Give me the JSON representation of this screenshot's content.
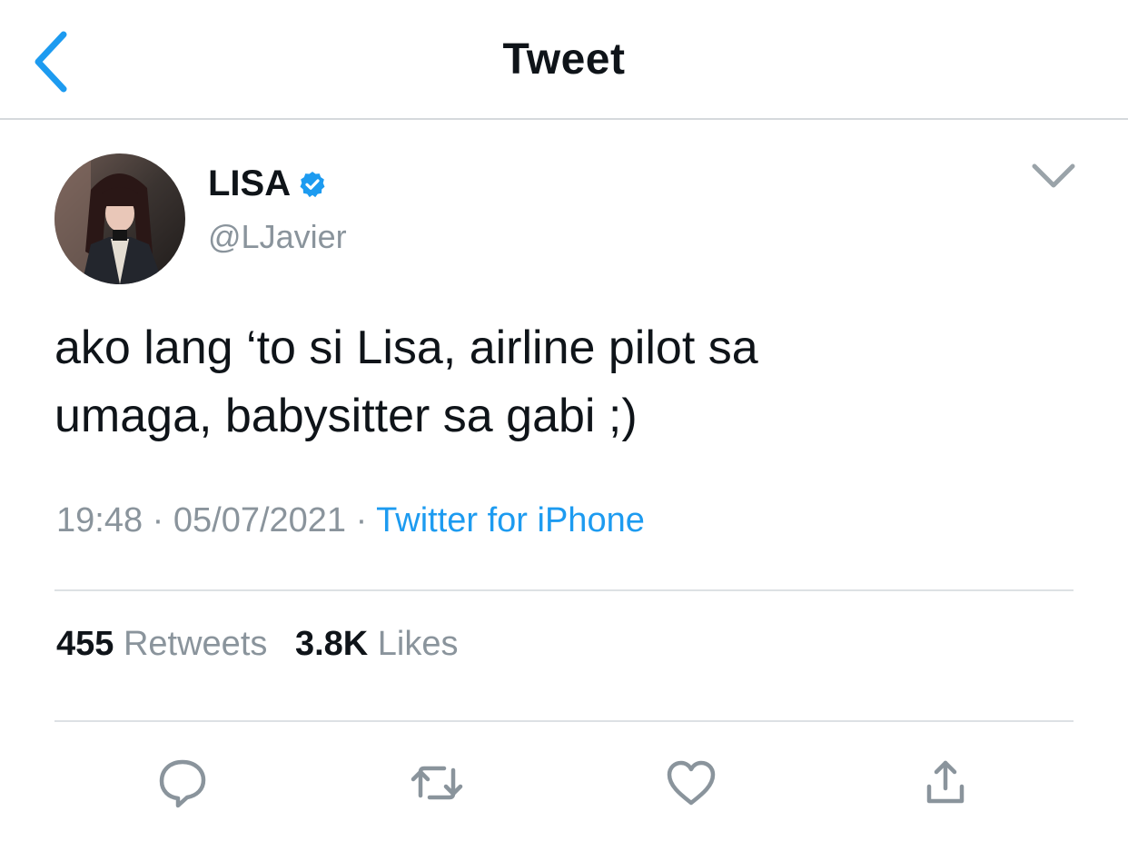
{
  "header": {
    "title": "Tweet",
    "back_icon": "chevron-left-icon",
    "accent_color": "#1d9bf0"
  },
  "tweet": {
    "author": {
      "display_name": "LISA",
      "handle": "@LJavier",
      "verified": true,
      "verified_icon": "verified-badge-icon"
    },
    "menu_icon": "chevron-down-icon",
    "text_line1": "ako lang ‘to si Lisa, airline pilot sa",
    "text_line2": "umaga, babysitter sa gabi ;)",
    "time": "19:48",
    "date": "05/07/2021",
    "separator": "·",
    "source": "Twitter for iPhone",
    "stats": {
      "retweets_count": "455",
      "retweets_label": "Retweets",
      "likes_count": "3.8K",
      "likes_label": "Likes"
    },
    "actions": [
      {
        "name": "reply",
        "icon": "reply-icon"
      },
      {
        "name": "retweet",
        "icon": "retweet-icon"
      },
      {
        "name": "like",
        "icon": "heart-icon"
      },
      {
        "name": "share",
        "icon": "share-icon"
      }
    ]
  },
  "colors": {
    "text_primary": "#0f1419",
    "text_secondary": "#8a949c",
    "link": "#1d9bf0",
    "icon_gray": "#8a949c",
    "divider": "#dde1e4"
  }
}
